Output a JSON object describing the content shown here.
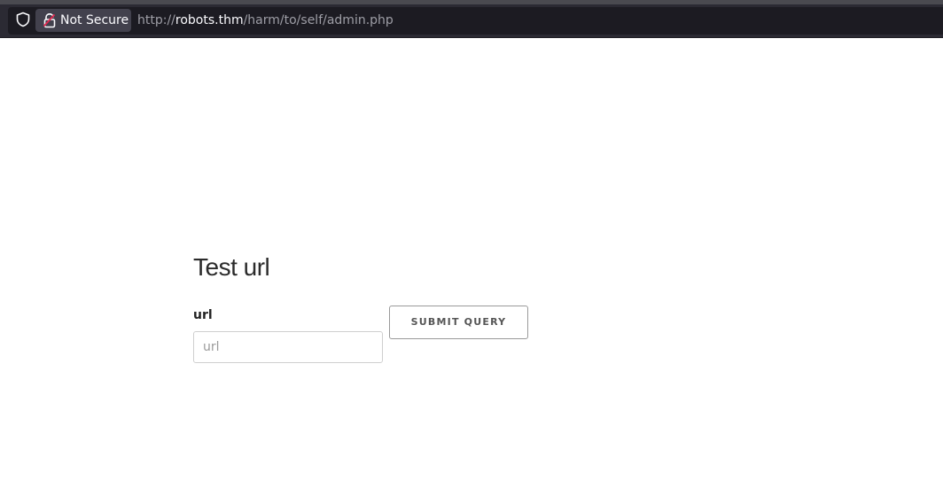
{
  "browser": {
    "security_label": "Not Secure",
    "url_scheme": "http://",
    "url_host": "robots.thm",
    "url_path": "/harm/to/self/admin.php",
    "icons": [
      "shield-icon",
      "lock-warning-icon"
    ]
  },
  "form": {
    "title": "Test url",
    "field_label": "url",
    "field_placeholder": "url",
    "field_value": "",
    "submit_label": "SUBMIT QUERY"
  }
}
